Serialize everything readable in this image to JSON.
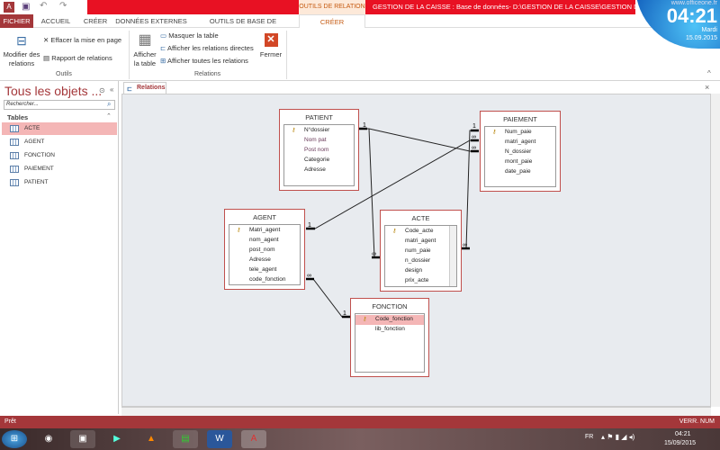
{
  "titlebar": {
    "context_tab": "OUTILS DE RELATION",
    "title": "GESTION DE LA CAISSE : Base de données- D:\\GESTION DE LA CAISSE\\GESTION DE LA CAISSE"
  },
  "clock": {
    "url": "www.officeone.fr",
    "time": "04:21",
    "day": "Mardi",
    "date": "15.09.2015"
  },
  "tabs": [
    "FICHIER",
    "ACCUEIL",
    "CRÉER",
    "DONNÉES EXTERNES",
    "OUTILS DE BASE DE DONNÉES",
    "CRÉER"
  ],
  "ribbon": {
    "modifier": "Modifier des relations",
    "effacer": "Effacer la mise en page",
    "rapport": "Rapport de relations",
    "outils": "Outils",
    "afficher_table": "Afficher la table",
    "masquer": "Masquer la table",
    "directes": "Afficher les relations directes",
    "toutes": "Afficher toutes les relations",
    "fermer": "Fermer",
    "relations": "Relations"
  },
  "nav": {
    "title": "Tous les objets ...",
    "search_placeholder": "Rechercher...",
    "section": "Tables",
    "items": [
      "ACTE",
      "AGENT",
      "FONCTION",
      "PAIEMENT",
      "PATIENT"
    ]
  },
  "doc_tab": "Relations",
  "tables": {
    "patient": {
      "name": "PATIENT",
      "fields": [
        "N°dossier",
        "Nom pat",
        "Post nom",
        "Categorie",
        "Adresse"
      ]
    },
    "paiement": {
      "name": "PAIEMENT",
      "fields": [
        "Num_paie",
        "matri_agent",
        "N_dossier",
        "mont_paie",
        "date_paie"
      ]
    },
    "agent": {
      "name": "AGENT",
      "fields": [
        "Matri_agent",
        "nom_agent",
        "post_nom",
        "Adresse",
        "tele_agent",
        "code_fonction"
      ]
    },
    "acte": {
      "name": "ACTE",
      "fields": [
        "Code_acte",
        "matri_agent",
        "num_paie",
        "n_dossier",
        "design",
        "prix_acte"
      ]
    },
    "fonction": {
      "name": "FONCTION",
      "fields": [
        "Code_fonction",
        "lib_fonction"
      ]
    }
  },
  "status": {
    "left": "Prêt",
    "right": "VERR. NUM"
  },
  "tray": {
    "lang": "FR",
    "time": "04:21",
    "date": "15/09/2015"
  }
}
